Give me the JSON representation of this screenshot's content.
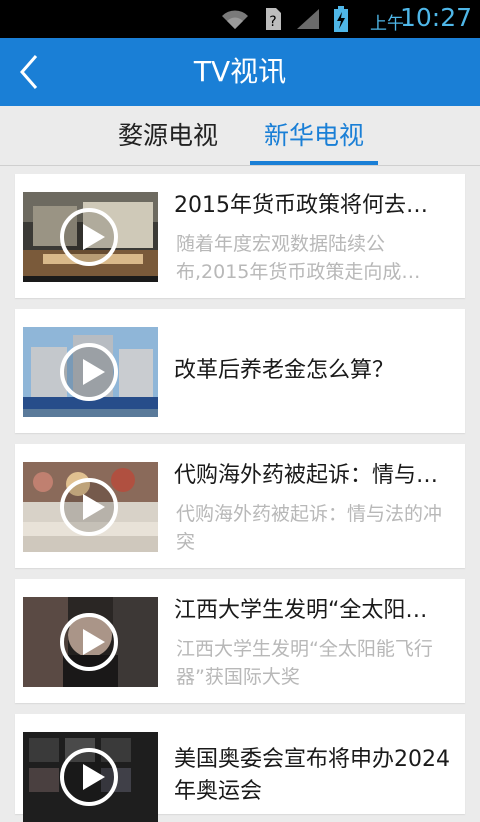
{
  "status_bar": {
    "ampm": "上午",
    "time": "10:27"
  },
  "header": {
    "title": "TV视讯"
  },
  "tabs": [
    {
      "label": "婺源电视"
    },
    {
      "label": "新华电视"
    }
  ],
  "active_tab": "新华电视",
  "items": [
    {
      "title": "2015年货币政策将何去…",
      "desc": "随着年度宏观数据陆续公布,2015年货币政策走向成…"
    },
    {
      "title": "改革后养老金怎么算？",
      "desc": ""
    },
    {
      "title": "代购海外药被起诉：情与…",
      "desc": "代购海外药被起诉：情与法的冲突"
    },
    {
      "title": "江西大学生发明“全太阳…",
      "desc": "江西大学生发明“全太阳能飞行器”获国际大奖"
    },
    {
      "title": "美国奥委会宣布将申办2024年奥运会",
      "desc": ""
    }
  ],
  "colors": {
    "accent": "#1a7fd6",
    "status_bar": "#000000",
    "background": "#ebebeb"
  }
}
